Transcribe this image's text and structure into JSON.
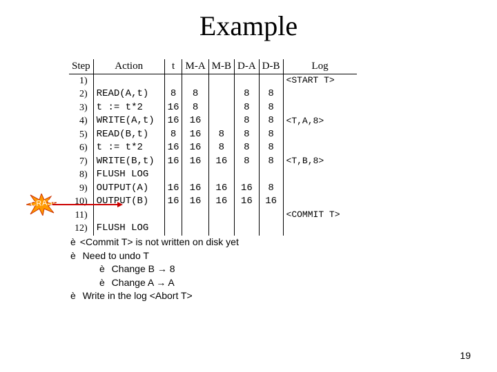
{
  "title": "Example",
  "headers": {
    "step": "Step",
    "action": "Action",
    "t": "t",
    "mA": "M-A",
    "mB": "M-B",
    "dA": "D-A",
    "dB": "D-B",
    "log": "Log"
  },
  "rows": [
    {
      "n": "1)",
      "action": "",
      "t": "",
      "mA": "",
      "mB": "",
      "dA": "",
      "dB": "",
      "log": "<START T>"
    },
    {
      "n": "2)",
      "action": "READ(A,t)",
      "t": "8",
      "mA": "8",
      "mB": "",
      "dA": "8",
      "dB": "8",
      "log": ""
    },
    {
      "n": "3)",
      "action": "t := t*2",
      "t": "16",
      "mA": "8",
      "mB": "",
      "dA": "8",
      "dB": "8",
      "log": ""
    },
    {
      "n": "4)",
      "action": "WRITE(A,t)",
      "t": "16",
      "mA": "16",
      "mB": "",
      "dA": "8",
      "dB": "8",
      "log": "<T,A,8>"
    },
    {
      "n": "5)",
      "action": "READ(B,t)",
      "t": "8",
      "mA": "16",
      "mB": "8",
      "dA": "8",
      "dB": "8",
      "log": ""
    },
    {
      "n": "6)",
      "action": "t := t*2",
      "t": "16",
      "mA": "16",
      "mB": "8",
      "dA": "8",
      "dB": "8",
      "log": ""
    },
    {
      "n": "7)",
      "action": "WRITE(B,t)",
      "t": "16",
      "mA": "16",
      "mB": "16",
      "dA": "8",
      "dB": "8",
      "log": "<T,B,8>"
    },
    {
      "n": "8)",
      "action": "FLUSH LOG",
      "t": "",
      "mA": "",
      "mB": "",
      "dA": "",
      "dB": "",
      "log": ""
    },
    {
      "n": "9)",
      "action": "OUTPUT(A)",
      "t": "16",
      "mA": "16",
      "mB": "16",
      "dA": "16",
      "dB": "8",
      "log": ""
    },
    {
      "n": "10)",
      "action": "OUTPUT(B)",
      "t": "16",
      "mA": "16",
      "mB": "16",
      "dA": "16",
      "dB": "16",
      "log": ""
    },
    {
      "n": "11)",
      "action": "",
      "t": "",
      "mA": "",
      "mB": "",
      "dA": "",
      "dB": "",
      "log": "<COMMIT T>"
    },
    {
      "n": "12)",
      "action": "FLUSH LOG",
      "t": "",
      "mA": "",
      "mB": "",
      "dA": "",
      "dB": "",
      "log": ""
    }
  ],
  "crash_label": "CRASH!",
  "bullets": {
    "b1": "<Commit T> is not written on disk yet",
    "b2": " Need to undo T",
    "b3": " Change B → 8",
    "b4": " Change A → A",
    "b5": " Write in the log <Abort T>"
  },
  "arrow_glyph": "è",
  "page": "19"
}
